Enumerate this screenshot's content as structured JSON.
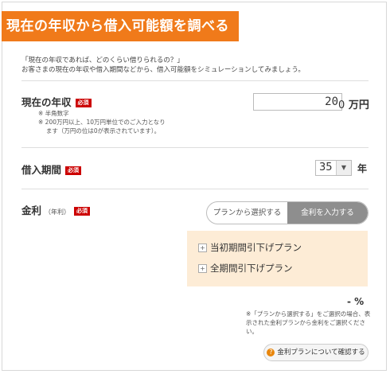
{
  "header": {
    "title": "現在の年収から借入可能額を調べる"
  },
  "intro": {
    "line1": "「現在の年収であれば、どのくらい借りられるの？」",
    "line2": "お客さまの現在の年収や借入期間などから、借入可能額をシミュレーションしてみましょう。"
  },
  "income": {
    "label": "現在の年収",
    "required": "必須",
    "note1": "※ 半角数字",
    "note2": "※ 200万円以上、10万円単位でのご入力となり",
    "note3": "　 ます（万円の位は0が表示されています）。",
    "value": "20",
    "fixed_digit": "0",
    "unit": "万円"
  },
  "period": {
    "label": "借入期間",
    "required": "必須",
    "selected": "35",
    "arrow": "▼",
    "unit": "年"
  },
  "rate": {
    "label": "金利",
    "sublabel": "（年利）",
    "required": "必須",
    "toggle": {
      "option1": "プランから選択する",
      "option2": "金利を入力する"
    },
    "plans": [
      {
        "label": "当初期間引下げプラン"
      },
      {
        "label": "全期間引下げプラン"
      }
    ],
    "plus": "+",
    "percent_value": "-",
    "percent_unit": "%",
    "footnote": "※「プランから選択する」をご選択の場合、表示された金利プランから金利をご選択ください。"
  },
  "confirm_button": {
    "icon": "?",
    "label": "金利プランについて確認する"
  },
  "colors": {
    "header_bg": "#f07a1a",
    "required_bg": "#cc0000",
    "panel_bg": "#fdecd6"
  }
}
